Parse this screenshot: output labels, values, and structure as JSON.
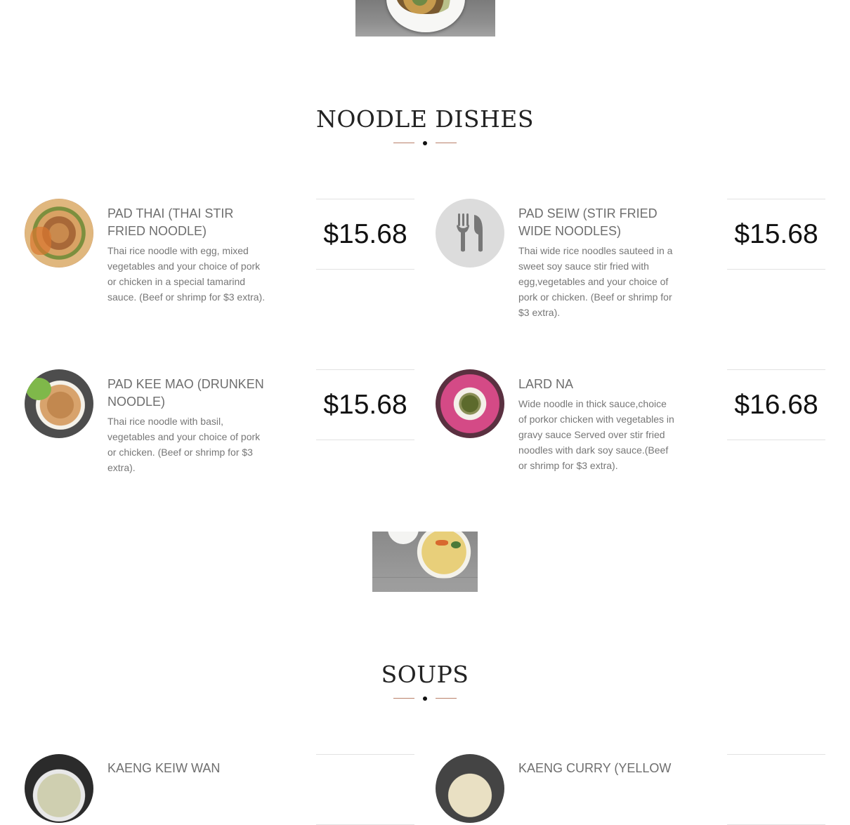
{
  "noodle_section": {
    "title": "NOODLE DISHES",
    "items": [
      {
        "name": "PAD THAI (THAI STIR FRIED NOODLE)",
        "description": "Thai rice noodle with egg, mixed vegetables and your choice of pork or chicken in a special tamarind sauce. (Beef or shrimp for $3 extra).",
        "price": "$15.68"
      },
      {
        "name": "PAD SEIW (STIR FRIED WIDE NOODLES)",
        "description": "Thai wide rice noodles sauteed in a sweet soy sauce stir fried with egg,vegetables and your choice of pork or chicken. (Beef or shrimp for $3 extra).",
        "price": "$15.68",
        "icon": "fork-knife-icon"
      },
      {
        "name": "PAD KEE MAO (DRUNKEN NOODLE)",
        "description": "Thai rice noodle with basil, vegetables and your choice of pork or chicken. (Beef or shrimp for $3 extra).",
        "price": "$15.68"
      },
      {
        "name": "LARD NA",
        "description": "Wide noodle in thick sauce,choice of porkor chicken with vegetables in gravy sauce Served over stir fried noodles with dark soy sauce.(Beef or shrimp for $3 extra).",
        "price": "$16.68"
      }
    ]
  },
  "soups_section": {
    "title": "SOUPS",
    "items": [
      {
        "name": "KAENG KEIW WAN"
      },
      {
        "name": "KAENG CURRY (YELLOW"
      }
    ]
  },
  "colors": {
    "divider_line": "#b9806a",
    "price_border": "#e2e2e2",
    "title_text": "#222222"
  }
}
